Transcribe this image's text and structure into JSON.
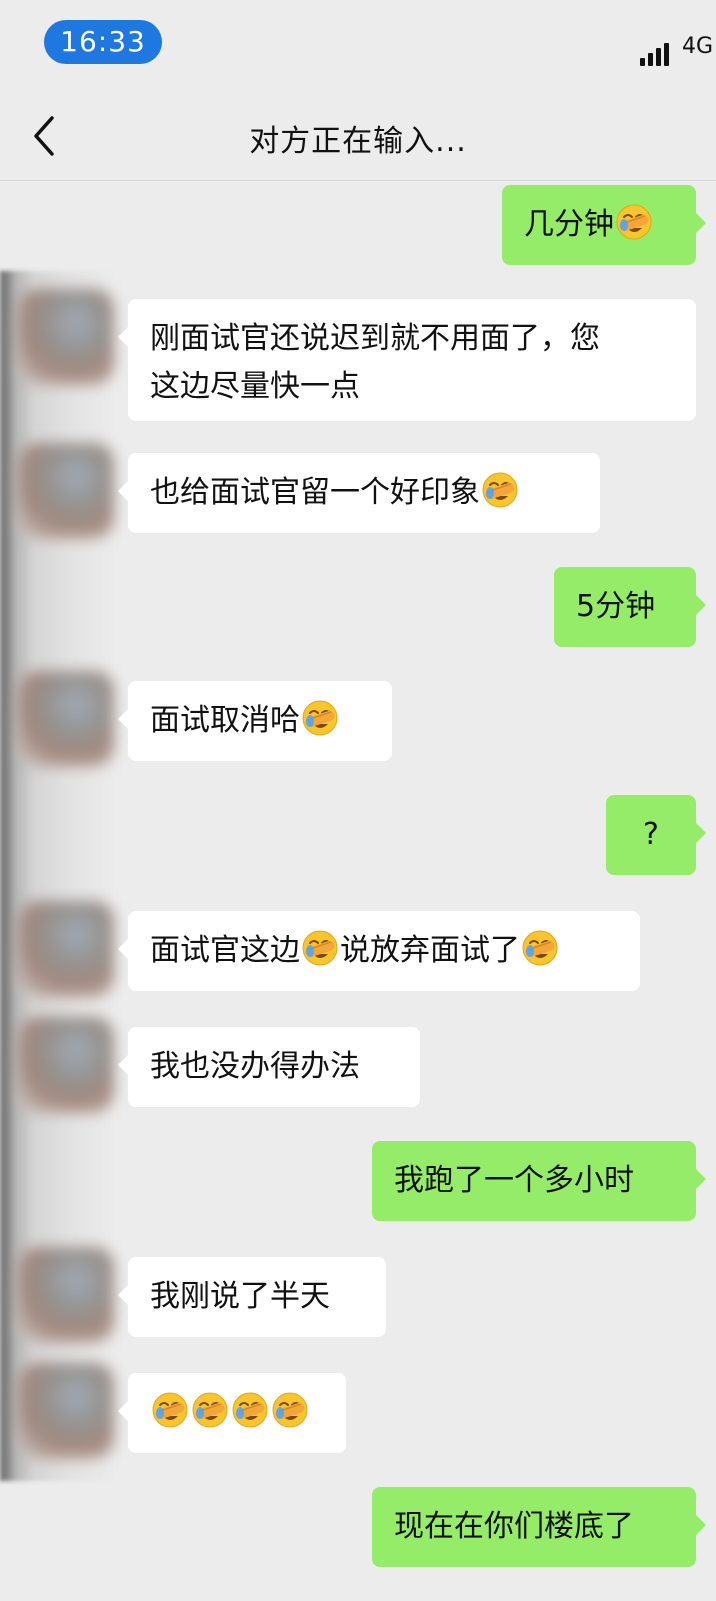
{
  "status_bar": {
    "time": "16:33",
    "network": "4G"
  },
  "header": {
    "title": "对方正在输入..."
  },
  "messages": [
    {
      "side": "right",
      "text": "几分钟",
      "emoji_after": 1
    },
    {
      "side": "left",
      "line1": "刚面试官还说迟到就不用面了，您",
      "line2": "这边尽量快一点"
    },
    {
      "side": "left",
      "text": "也给面试官留一个好印象",
      "emoji_after": 1
    },
    {
      "side": "right",
      "text": "5分钟"
    },
    {
      "side": "left",
      "text": "面试取消哈",
      "emoji_after": 1
    },
    {
      "side": "right",
      "text": "?"
    },
    {
      "side": "left",
      "part1": "面试官这边",
      "part2": "说放弃面试了",
      "emoji_after": 1
    },
    {
      "side": "left",
      "text": "我也没办得办法"
    },
    {
      "side": "right",
      "text": "我跑了一个多小时"
    },
    {
      "side": "left",
      "text": "我刚说了半天"
    },
    {
      "side": "left",
      "emoji_count": 4
    },
    {
      "side": "right",
      "text": "现在在你们楼底了"
    }
  ],
  "icons": {
    "back": "chevron-left-icon",
    "emoji": "face-with-hand-over-eyes-emoji",
    "signal": "signal-icon"
  },
  "colors": {
    "background": "#ececec",
    "outgoing_bubble": "#95ec69",
    "incoming_bubble": "#ffffff",
    "time_pill": "#1f78e0"
  }
}
